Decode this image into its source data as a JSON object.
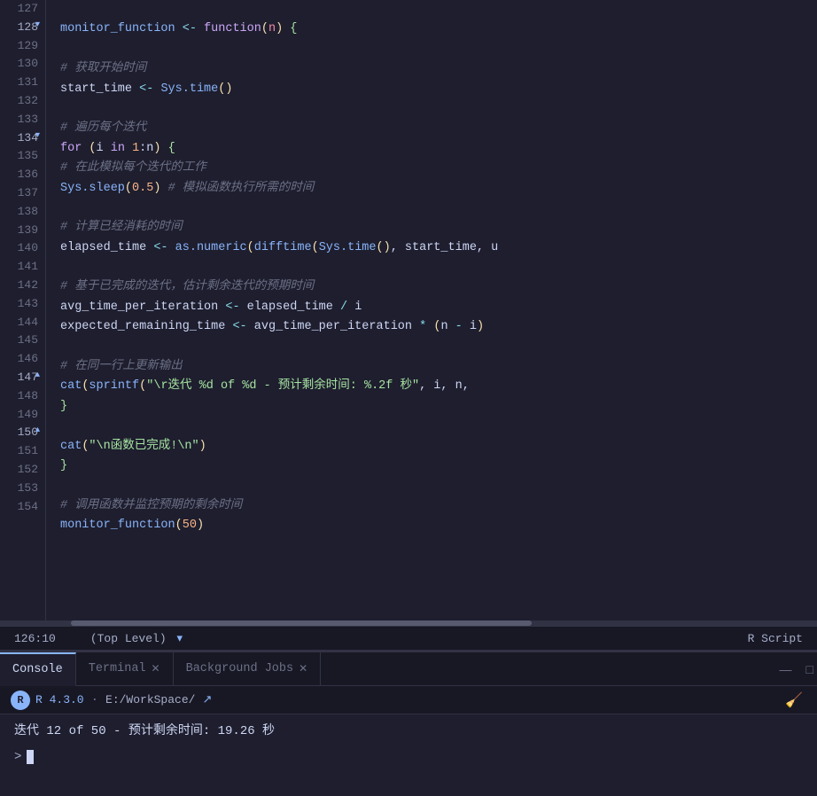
{
  "title": "monitor function",
  "editor": {
    "lines": [
      {
        "num": "127",
        "content": ""
      },
      {
        "num": "128",
        "indicator": "▾",
        "content_parts": [
          {
            "t": "fn",
            "v": "monitor_function"
          },
          {
            "t": "plain",
            "v": " "
          },
          {
            "t": "arrow",
            "v": "<-"
          },
          {
            "t": "plain",
            "v": " "
          },
          {
            "t": "kw",
            "v": "function"
          },
          {
            "t": "paren",
            "v": "("
          },
          {
            "t": "param",
            "v": "n"
          },
          {
            "t": "paren",
            "v": ")"
          },
          {
            "t": "plain",
            "v": " "
          },
          {
            "t": "bracket",
            "v": "{"
          }
        ]
      },
      {
        "num": "129",
        "content": ""
      },
      {
        "num": "130",
        "content_parts": [
          {
            "t": "plain",
            "v": "    "
          },
          {
            "t": "cm",
            "v": "# 获取开始时间"
          }
        ]
      },
      {
        "num": "131",
        "content_parts": [
          {
            "t": "plain",
            "v": "    "
          },
          {
            "t": "var",
            "v": "start_time"
          },
          {
            "t": "plain",
            "v": " "
          },
          {
            "t": "arrow",
            "v": "<-"
          },
          {
            "t": "plain",
            "v": " "
          },
          {
            "t": "builtin",
            "v": "Sys.time"
          },
          {
            "t": "paren",
            "v": "()"
          }
        ]
      },
      {
        "num": "132",
        "content": ""
      },
      {
        "num": "133",
        "content_parts": [
          {
            "t": "plain",
            "v": "    "
          },
          {
            "t": "cm",
            "v": "# 遍历每个迭代"
          }
        ]
      },
      {
        "num": "134",
        "indicator": "▾",
        "content_parts": [
          {
            "t": "plain",
            "v": "    "
          },
          {
            "t": "kw",
            "v": "for"
          },
          {
            "t": "plain",
            "v": " "
          },
          {
            "t": "paren",
            "v": "("
          },
          {
            "t": "var",
            "v": "i"
          },
          {
            "t": "plain",
            "v": " "
          },
          {
            "t": "kw",
            "v": "in"
          },
          {
            "t": "plain",
            "v": " "
          },
          {
            "t": "num",
            "v": "1"
          },
          {
            "t": "plain",
            "v": ":"
          },
          {
            "t": "var",
            "v": "n"
          },
          {
            "t": "paren",
            "v": ")"
          },
          {
            "t": "plain",
            "v": " "
          },
          {
            "t": "bracket",
            "v": "{"
          }
        ]
      },
      {
        "num": "135",
        "content_parts": [
          {
            "t": "plain",
            "v": "        "
          },
          {
            "t": "cm",
            "v": "# 在此模拟每个迭代的工作"
          }
        ]
      },
      {
        "num": "136",
        "content_parts": [
          {
            "t": "plain",
            "v": "        "
          },
          {
            "t": "builtin",
            "v": "Sys.sleep"
          },
          {
            "t": "paren",
            "v": "("
          },
          {
            "t": "num",
            "v": "0.5"
          },
          {
            "t": "paren",
            "v": ")"
          },
          {
            "t": "plain",
            "v": " "
          },
          {
            "t": "cm",
            "v": "# 模拟函数执行所需的时间"
          }
        ]
      },
      {
        "num": "137",
        "content": ""
      },
      {
        "num": "138",
        "content_parts": [
          {
            "t": "plain",
            "v": "        "
          },
          {
            "t": "cm",
            "v": "# 计算已经消耗的时间"
          }
        ]
      },
      {
        "num": "139",
        "content_parts": [
          {
            "t": "plain",
            "v": "        "
          },
          {
            "t": "var",
            "v": "elapsed_time"
          },
          {
            "t": "plain",
            "v": " "
          },
          {
            "t": "arrow",
            "v": "<-"
          },
          {
            "t": "plain",
            "v": " "
          },
          {
            "t": "builtin",
            "v": "as.numeric"
          },
          {
            "t": "paren",
            "v": "("
          },
          {
            "t": "builtin",
            "v": "difftime"
          },
          {
            "t": "paren",
            "v": "("
          },
          {
            "t": "builtin",
            "v": "Sys.time"
          },
          {
            "t": "paren",
            "v": "()"
          },
          {
            "t": "plain",
            "v": ", "
          },
          {
            "t": "var",
            "v": "start_time"
          },
          {
            "t": "plain",
            "v": ", u"
          }
        ]
      },
      {
        "num": "140",
        "content": ""
      },
      {
        "num": "141",
        "content_parts": [
          {
            "t": "plain",
            "v": "        "
          },
          {
            "t": "cm",
            "v": "# 基于已完成的迭代，估计剩余迭代的预期时间"
          }
        ]
      },
      {
        "num": "142",
        "content_parts": [
          {
            "t": "plain",
            "v": "        "
          },
          {
            "t": "var",
            "v": "avg_time_per_iteration"
          },
          {
            "t": "plain",
            "v": " "
          },
          {
            "t": "arrow",
            "v": "<-"
          },
          {
            "t": "plain",
            "v": " "
          },
          {
            "t": "var",
            "v": "elapsed_time"
          },
          {
            "t": "plain",
            "v": " "
          },
          {
            "t": "op",
            "v": "/"
          },
          {
            "t": "plain",
            "v": " "
          },
          {
            "t": "var",
            "v": "i"
          }
        ]
      },
      {
        "num": "143",
        "content_parts": [
          {
            "t": "plain",
            "v": "        "
          },
          {
            "t": "var",
            "v": "expected_remaining_time"
          },
          {
            "t": "plain",
            "v": " "
          },
          {
            "t": "arrow",
            "v": "<-"
          },
          {
            "t": "plain",
            "v": " "
          },
          {
            "t": "var",
            "v": "avg_time_per_iteration"
          },
          {
            "t": "plain",
            "v": " "
          },
          {
            "t": "op",
            "v": "*"
          },
          {
            "t": "plain",
            "v": " "
          },
          {
            "t": "paren",
            "v": "("
          },
          {
            "t": "var",
            "v": "n"
          },
          {
            "t": "plain",
            "v": " "
          },
          {
            "t": "op",
            "v": "-"
          },
          {
            "t": "plain",
            "v": " "
          },
          {
            "t": "var",
            "v": "i"
          },
          {
            "t": "paren",
            "v": ")"
          }
        ]
      },
      {
        "num": "144",
        "content": ""
      },
      {
        "num": "145",
        "content_parts": [
          {
            "t": "plain",
            "v": "        "
          },
          {
            "t": "cm",
            "v": "# 在同一行上更新输出"
          }
        ]
      },
      {
        "num": "146",
        "content_parts": [
          {
            "t": "plain",
            "v": "        "
          },
          {
            "t": "builtin",
            "v": "cat"
          },
          {
            "t": "paren",
            "v": "("
          },
          {
            "t": "builtin",
            "v": "sprintf"
          },
          {
            "t": "paren",
            "v": "("
          },
          {
            "t": "str",
            "v": "\"\\r迭代 %d of %d - 预计剩余时间: %.2f 秒\""
          },
          {
            "t": "plain",
            "v": ", "
          },
          {
            "t": "var",
            "v": "i"
          },
          {
            "t": "plain",
            "v": ", n,"
          }
        ]
      },
      {
        "num": "147",
        "indicator": "▴",
        "content_parts": [
          {
            "t": "plain",
            "v": "    "
          },
          {
            "t": "bracket",
            "v": "}"
          }
        ]
      },
      {
        "num": "148",
        "content": ""
      },
      {
        "num": "149",
        "content_parts": [
          {
            "t": "plain",
            "v": "    "
          },
          {
            "t": "builtin",
            "v": "cat"
          },
          {
            "t": "paren",
            "v": "("
          },
          {
            "t": "str",
            "v": "\"\\n函数已完成!\\n\""
          },
          {
            "t": "paren",
            "v": ")"
          }
        ]
      },
      {
        "num": "150",
        "indicator": "▴",
        "content_parts": [
          {
            "t": "bracket",
            "v": "}"
          }
        ]
      },
      {
        "num": "151",
        "content": ""
      },
      {
        "num": "152",
        "content_parts": [
          {
            "t": "cm",
            "v": "# 调用函数并监控预期的剩余时间"
          }
        ]
      },
      {
        "num": "153",
        "content_parts": [
          {
            "t": "fn",
            "v": "monitor_function"
          },
          {
            "t": "paren",
            "v": "("
          },
          {
            "t": "num",
            "v": "50"
          },
          {
            "t": "paren",
            "v": ")"
          }
        ]
      },
      {
        "num": "154",
        "content": ""
      }
    ],
    "status": {
      "position": "126:10",
      "scope": "(Top Level)",
      "file_type": "R Script"
    }
  },
  "bottom_panel": {
    "tabs": [
      {
        "id": "console",
        "label": "Console",
        "closeable": false,
        "active": true
      },
      {
        "id": "terminal",
        "label": "Terminal",
        "closeable": true,
        "active": false
      },
      {
        "id": "background-jobs",
        "label": "Background Jobs",
        "closeable": true,
        "active": false
      }
    ],
    "console": {
      "r_version": "R 4.3.0",
      "workspace": "E:/WorkSpace/",
      "output_line": "迭代 12 of 50 - 预计剩余时间: 19.26 秒",
      "prompt": ">"
    },
    "icons": {
      "minimize": "—",
      "maximize": "□",
      "clear": "🧹"
    }
  }
}
